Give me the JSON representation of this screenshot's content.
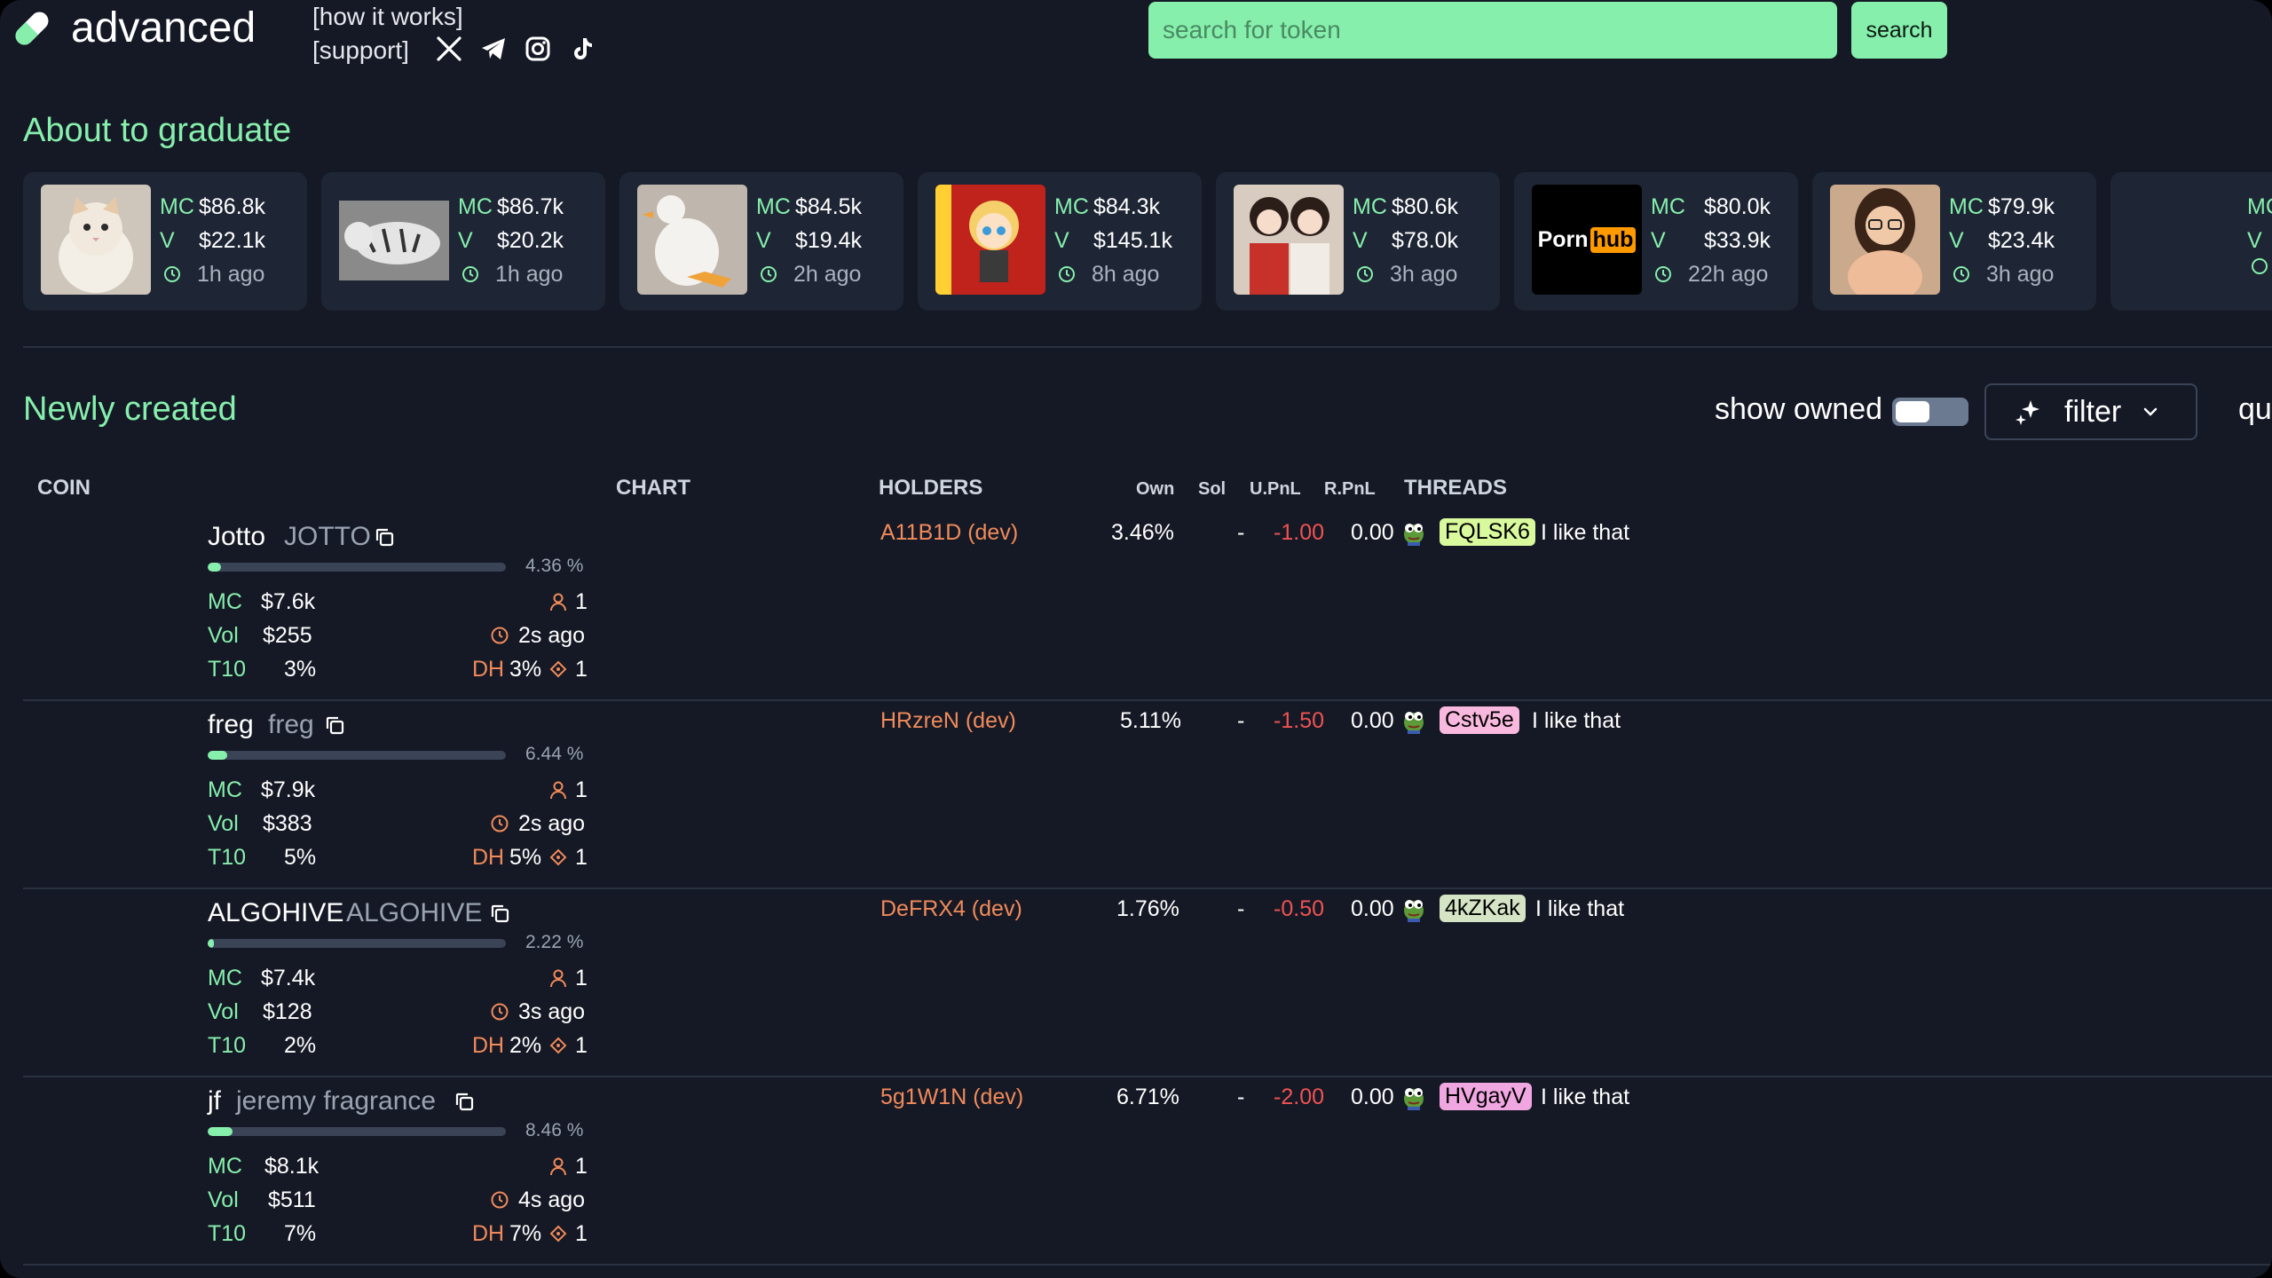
{
  "header": {
    "brand": "advanced",
    "how_it_works": "[how it works]",
    "support": "[support]",
    "search_placeholder": "search for token",
    "search_button": "search"
  },
  "graduate": {
    "title": "About to graduate",
    "cards": [
      {
        "mc_label": "MC",
        "mc": "$86.8k",
        "v_label": "V",
        "v": "$22.1k",
        "age": "1h ago",
        "image": "cat-photo"
      },
      {
        "mc_label": "MC",
        "mc": "$86.7k",
        "v_label": "V",
        "v": "$20.2k",
        "age": "1h ago",
        "image": "white-tiger-photo"
      },
      {
        "mc_label": "MC",
        "mc": "$84.5k",
        "v_label": "V",
        "v": "$19.4k",
        "age": "2h ago",
        "image": "goose-plush-photo"
      },
      {
        "mc_label": "MC",
        "mc": "$84.3k",
        "v_label": "V",
        "v": "$145.1k",
        "age": "8h ago",
        "image": "anime-character-art"
      },
      {
        "mc_label": "MC",
        "mc": "$80.6k",
        "v_label": "V",
        "v": "$78.0k",
        "age": "3h ago",
        "image": "anime-girls-art"
      },
      {
        "mc_label": "MC",
        "mc": "$80.0k",
        "v_label": "V",
        "v": "$33.9k",
        "age": "22h ago",
        "image": "logo-image",
        "logo_left": "Porn",
        "logo_right": "hub"
      },
      {
        "mc_label": "MC",
        "mc": "$79.9k",
        "v_label": "V",
        "v": "$23.4k",
        "age": "3h ago",
        "image": "woman-glasses-photo"
      },
      {
        "mc_label": "MC",
        "mc": "",
        "v_label": "V",
        "v": "",
        "age": "",
        "image": ""
      }
    ]
  },
  "newly": {
    "title": "Newly created",
    "show_owned": "show owned",
    "show_owned_on": false,
    "filter": "filter",
    "overflow": "qu"
  },
  "table": {
    "headers": {
      "coin": "COIN",
      "chart": "CHART",
      "holders": "HOLDERS",
      "own": "Own",
      "sol": "Sol",
      "upnl": "U.PnL",
      "rpnl": "R.PnL",
      "threads": "THREADS"
    },
    "rows": [
      {
        "name": "Jotto",
        "ticker": "JOTTO",
        "progress": 4.36,
        "progress_text": "4.36 %",
        "mc_label": "MC",
        "mc": "$7.6k",
        "holders_count": "1",
        "vol_label": "Vol",
        "vol": "$255",
        "age": "2s ago",
        "t10_label": "T10",
        "t10": "3%",
        "dh_label": "DH",
        "dh": "3%",
        "snipers": "1",
        "holder": "A11B1D (dev)",
        "own": "3.46%",
        "sol": "-",
        "upnl": "-1.00",
        "rpnl": "0.00",
        "thread_tag": "FQLSK6",
        "thread_tag_color": "#d9f99d",
        "thread_text": "I like that"
      },
      {
        "name": "freg",
        "ticker": "freg",
        "progress": 6.44,
        "progress_text": "6.44 %",
        "mc_label": "MC",
        "mc": "$7.9k",
        "holders_count": "1",
        "vol_label": "Vol",
        "vol": "$383",
        "age": "2s ago",
        "t10_label": "T10",
        "t10": "5%",
        "dh_label": "DH",
        "dh": "5%",
        "snipers": "1",
        "holder": "HRzreN (dev)",
        "own": "5.11%",
        "sol": "-",
        "upnl": "-1.50",
        "rpnl": "0.00",
        "thread_tag": "Cstv5e",
        "thread_tag_color": "#f9b8de",
        "thread_text": "I like that"
      },
      {
        "name": "ALGOHIVE",
        "ticker": "ALGOHIVE",
        "progress": 2.22,
        "progress_text": "2.22 %",
        "mc_label": "MC",
        "mc": "$7.4k",
        "holders_count": "1",
        "vol_label": "Vol",
        "vol": "$128",
        "age": "3s ago",
        "t10_label": "T10",
        "t10": "2%",
        "dh_label": "DH",
        "dh": "2%",
        "snipers": "1",
        "holder": "DeFRX4 (dev)",
        "own": "1.76%",
        "sol": "-",
        "upnl": "-0.50",
        "rpnl": "0.00",
        "thread_tag": "4kZKak",
        "thread_tag_color": "#d4e4c4",
        "thread_text": "I like that"
      },
      {
        "name": "jf",
        "ticker": "jeremy fragrance",
        "progress": 8.46,
        "progress_text": "8.46 %",
        "mc_label": "MC",
        "mc": "$8.1k",
        "holders_count": "1",
        "vol_label": "Vol",
        "vol": "$511",
        "age": "4s ago",
        "t10_label": "T10",
        "t10": "7%",
        "dh_label": "DH",
        "dh": "7%",
        "snipers": "1",
        "holder": "5g1W1N (dev)",
        "own": "6.71%",
        "sol": "-",
        "upnl": "-2.00",
        "rpnl": "0.00",
        "thread_tag": "HVgayV",
        "thread_tag_color": "#f0a6e0",
        "thread_text": "I like that"
      }
    ]
  },
  "colors": {
    "accent": "#86efac",
    "background": "#151925",
    "card": "#1e2534",
    "holder": "#f18a5a",
    "negative": "#f05252"
  }
}
